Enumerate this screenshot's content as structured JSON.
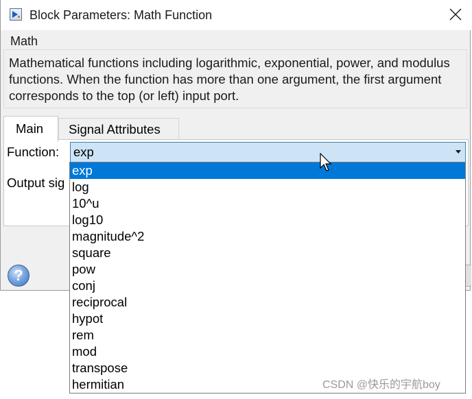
{
  "window": {
    "title": "Block Parameters: Math Function",
    "icons": {
      "app": "simulink-block-icon",
      "close": "close-icon",
      "help": "help-icon"
    }
  },
  "group": {
    "title": "Math",
    "description": "Mathematical functions including logarithmic, exponential, power, and modulus functions.  When the function has more than one argument, the first argument corresponds to the top (or left) input port."
  },
  "tabs": [
    {
      "label": "Main",
      "active": true
    },
    {
      "label": "Signal Attributes",
      "active": false
    }
  ],
  "main": {
    "function_label": "Function:",
    "function_value": "exp",
    "output_label": "Output sig"
  },
  "dropdown": {
    "options": [
      "exp",
      "log",
      "10^u",
      "log10",
      "magnitude^2",
      "square",
      "pow",
      "conj",
      "reciprocal",
      "hypot",
      "rem",
      "mod",
      "transpose",
      "hermitian"
    ],
    "selected": "exp"
  },
  "colors": {
    "selection": "#0078d7",
    "combo_highlight": "#cde4f7",
    "window_bg": "#f0f0f0"
  },
  "watermark": "CSDN @快乐的宇航boy"
}
